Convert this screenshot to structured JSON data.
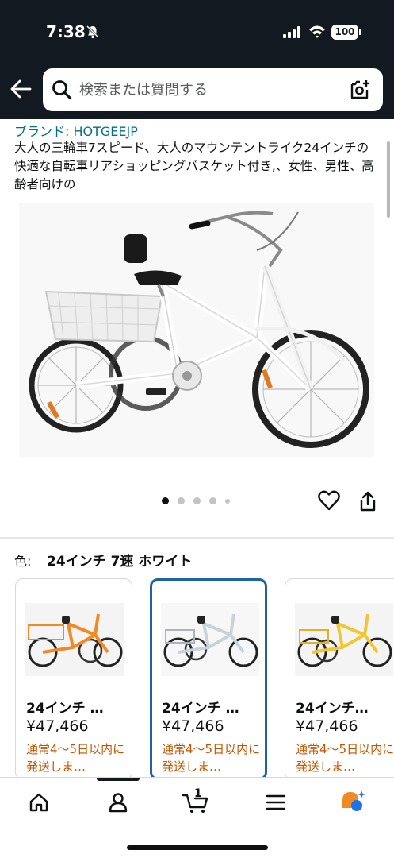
{
  "status_bar": {
    "time": "7:38",
    "battery": "100",
    "icons": [
      "bell-muted-icon",
      "signal-icon",
      "wifi-icon",
      "battery-icon"
    ]
  },
  "search": {
    "placeholder": "検索または質問する",
    "icons": [
      "back-arrow-icon",
      "search-icon",
      "camera-icon"
    ]
  },
  "product": {
    "brand": "ブランド: HOTGEEJP",
    "title": "大人の三輪車7スピード、大人のマウンテントライク24インチの快適な自転車リアショッピングバスケット付き,、女性、男性、高齢者向けの",
    "image_count": 5,
    "active_image_index": 0
  },
  "variation": {
    "label": "色:",
    "selected_value": "24インチ 7速 ホワイト",
    "options": [
      {
        "name": "24インチ …",
        "price": "¥47,466",
        "shipping": "通常4～5日以内に発送しま…",
        "color": "#f08a24",
        "selected": false
      },
      {
        "name": "24インチ …",
        "price": "¥47,466",
        "shipping": "通常4～5日以内に発送しま…",
        "color": "#e8eef2",
        "selected": true
      },
      {
        "name": "24インチ…",
        "price": "¥47,466",
        "shipping": "通常4～5日以内に発送しま…",
        "color": "#f2c531",
        "selected": false
      }
    ]
  },
  "bottom_nav": {
    "cart_count": "1",
    "items": [
      "home-icon",
      "account-icon",
      "cart-icon",
      "menu-icon",
      "rufus-icon"
    ]
  },
  "colors": {
    "header_bg": "#131921",
    "link": "#007185",
    "shipping_text": "#c45500",
    "selected_border": "#2162a1"
  }
}
